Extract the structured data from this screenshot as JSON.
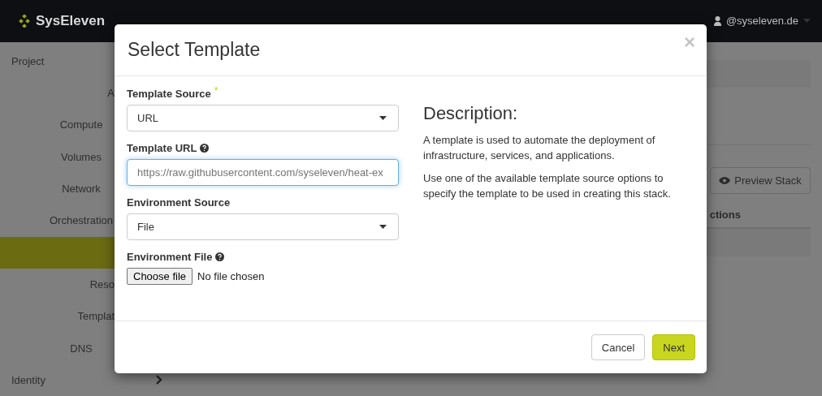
{
  "navbar": {
    "brand": "SysEleven",
    "user": "@syseleven.de"
  },
  "sidebar": {
    "items": [
      {
        "label": "Project",
        "kind": "section",
        "selected": false
      },
      {
        "label": "A",
        "kind": "cut",
        "selected": false
      },
      {
        "label": "Compute",
        "kind": "item",
        "selected": false
      },
      {
        "label": "Volumes",
        "kind": "item",
        "selected": false
      },
      {
        "label": "Network",
        "kind": "item",
        "selected": false
      },
      {
        "label": "Orchestration",
        "kind": "item",
        "selected": false
      },
      {
        "kind": "item",
        "selected": true
      },
      {
        "label": "Reso",
        "kind": "cut",
        "selected": false
      },
      {
        "label": "Templat",
        "kind": "cut",
        "selected": false
      },
      {
        "label": "DNS",
        "kind": "item",
        "selected": false
      },
      {
        "label": "Identity",
        "kind": "section",
        "selected": false
      }
    ]
  },
  "content": {
    "preview_button": "Preview Stack",
    "table_header": "ctions"
  },
  "dialog": {
    "title": "Select Template",
    "close": "×",
    "fields": [
      {
        "kind": "select",
        "label": "Template Source",
        "required_mark": "*",
        "help": false,
        "value": "URL"
      },
      {
        "kind": "input",
        "label": "Template URL",
        "help": true,
        "placeholder": "https://raw.githubusercontent.com/syseleven/heat-ex"
      },
      {
        "kind": "select",
        "label": "Environment Source",
        "help": false,
        "value": "File"
      },
      {
        "kind": "file",
        "label": "Environment File",
        "help": true,
        "button": "Choose file",
        "value": "No file chosen"
      }
    ],
    "description": {
      "heading": "Description:",
      "paragraphs": [
        "A template is used to automate the deployment of infrastructure, services, and applications.",
        "Use one of the available template source options to specify the template to be used in creating this stack."
      ]
    },
    "buttons": [
      {
        "label": "Cancel",
        "kind": "default"
      },
      {
        "label": "Next",
        "kind": "primary"
      }
    ]
  }
}
